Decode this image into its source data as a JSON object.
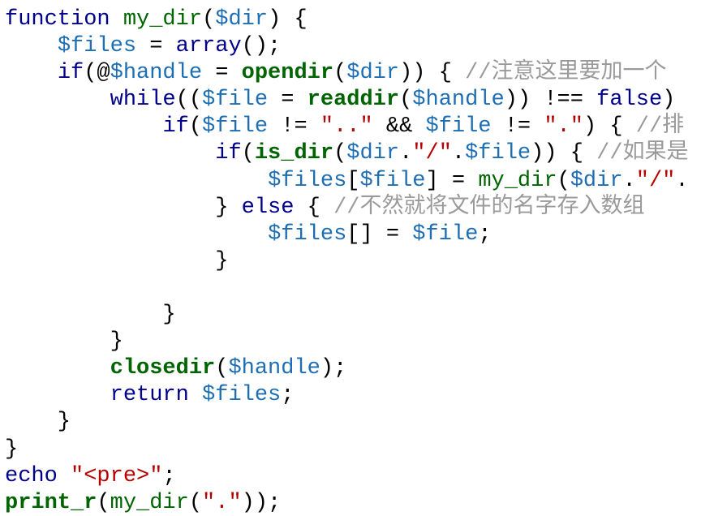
{
  "colors": {
    "background": "#FFFFFF",
    "plain": "#000000",
    "keyword": "#00008B",
    "function": "#006400",
    "builtin": "#006400",
    "variable": "#1E6EB4",
    "string": "#B40000",
    "comment": "#9A9A9A"
  },
  "code": {
    "lines": [
      [
        {
          "t": "keyword",
          "v": "function"
        },
        {
          "t": "plain",
          "v": " "
        },
        {
          "t": "func",
          "v": "my_dir"
        },
        {
          "t": "plain",
          "v": "("
        },
        {
          "t": "var",
          "v": "$dir"
        },
        {
          "t": "plain",
          "v": ") {"
        }
      ],
      [
        {
          "t": "plain",
          "v": "    "
        },
        {
          "t": "var",
          "v": "$files"
        },
        {
          "t": "plain",
          "v": " = "
        },
        {
          "t": "keyword",
          "v": "array"
        },
        {
          "t": "plain",
          "v": "();"
        }
      ],
      [
        {
          "t": "plain",
          "v": "    "
        },
        {
          "t": "keyword",
          "v": "if"
        },
        {
          "t": "plain",
          "v": "(@"
        },
        {
          "t": "var",
          "v": "$handle"
        },
        {
          "t": "plain",
          "v": " = "
        },
        {
          "t": "builtin",
          "v": "opendir"
        },
        {
          "t": "plain",
          "v": "("
        },
        {
          "t": "var",
          "v": "$dir"
        },
        {
          "t": "plain",
          "v": ")) { "
        },
        {
          "t": "comment",
          "v": "//注意这里要加一个"
        }
      ],
      [
        {
          "t": "plain",
          "v": "        "
        },
        {
          "t": "keyword",
          "v": "while"
        },
        {
          "t": "plain",
          "v": "(("
        },
        {
          "t": "var",
          "v": "$file"
        },
        {
          "t": "plain",
          "v": " = "
        },
        {
          "t": "builtin",
          "v": "readdir"
        },
        {
          "t": "plain",
          "v": "("
        },
        {
          "t": "var",
          "v": "$handle"
        },
        {
          "t": "plain",
          "v": ")) !== "
        },
        {
          "t": "keyword",
          "v": "false"
        },
        {
          "t": "plain",
          "v": ") "
        }
      ],
      [
        {
          "t": "plain",
          "v": "            "
        },
        {
          "t": "keyword",
          "v": "if"
        },
        {
          "t": "plain",
          "v": "("
        },
        {
          "t": "var",
          "v": "$file"
        },
        {
          "t": "plain",
          "v": " != "
        },
        {
          "t": "string",
          "v": "\"..\""
        },
        {
          "t": "plain",
          "v": " && "
        },
        {
          "t": "var",
          "v": "$file"
        },
        {
          "t": "plain",
          "v": " != "
        },
        {
          "t": "string",
          "v": "\".\""
        },
        {
          "t": "plain",
          "v": ") { "
        },
        {
          "t": "comment",
          "v": "//排"
        }
      ],
      [
        {
          "t": "plain",
          "v": "                "
        },
        {
          "t": "keyword",
          "v": "if"
        },
        {
          "t": "plain",
          "v": "("
        },
        {
          "t": "builtin",
          "v": "is_dir"
        },
        {
          "t": "plain",
          "v": "("
        },
        {
          "t": "var",
          "v": "$dir"
        },
        {
          "t": "plain",
          "v": "."
        },
        {
          "t": "string",
          "v": "\"/\""
        },
        {
          "t": "plain",
          "v": "."
        },
        {
          "t": "var",
          "v": "$file"
        },
        {
          "t": "plain",
          "v": ")) { "
        },
        {
          "t": "comment",
          "v": "//如果是"
        }
      ],
      [
        {
          "t": "plain",
          "v": "                    "
        },
        {
          "t": "var",
          "v": "$files"
        },
        {
          "t": "plain",
          "v": "["
        },
        {
          "t": "var",
          "v": "$file"
        },
        {
          "t": "plain",
          "v": "] = "
        },
        {
          "t": "func",
          "v": "my_dir"
        },
        {
          "t": "plain",
          "v": "("
        },
        {
          "t": "var",
          "v": "$dir"
        },
        {
          "t": "plain",
          "v": "."
        },
        {
          "t": "string",
          "v": "\"/\""
        },
        {
          "t": "plain",
          "v": "."
        }
      ],
      [
        {
          "t": "plain",
          "v": "                } "
        },
        {
          "t": "keyword",
          "v": "else"
        },
        {
          "t": "plain",
          "v": " { "
        },
        {
          "t": "comment",
          "v": "//不然就将文件的名字存入数组"
        }
      ],
      [
        {
          "t": "plain",
          "v": "                    "
        },
        {
          "t": "var",
          "v": "$files"
        },
        {
          "t": "plain",
          "v": "[] = "
        },
        {
          "t": "var",
          "v": "$file"
        },
        {
          "t": "plain",
          "v": ";"
        }
      ],
      [
        {
          "t": "plain",
          "v": "                }"
        }
      ],
      [
        {
          "t": "plain",
          "v": ""
        }
      ],
      [
        {
          "t": "plain",
          "v": "            }"
        }
      ],
      [
        {
          "t": "plain",
          "v": "        }"
        }
      ],
      [
        {
          "t": "plain",
          "v": "        "
        },
        {
          "t": "builtin",
          "v": "closedir"
        },
        {
          "t": "plain",
          "v": "("
        },
        {
          "t": "var",
          "v": "$handle"
        },
        {
          "t": "plain",
          "v": ");"
        }
      ],
      [
        {
          "t": "plain",
          "v": "        "
        },
        {
          "t": "keyword",
          "v": "return"
        },
        {
          "t": "plain",
          "v": " "
        },
        {
          "t": "var",
          "v": "$files"
        },
        {
          "t": "plain",
          "v": ";"
        }
      ],
      [
        {
          "t": "plain",
          "v": "    }"
        }
      ],
      [
        {
          "t": "plain",
          "v": "}"
        }
      ],
      [
        {
          "t": "keyword",
          "v": "echo"
        },
        {
          "t": "plain",
          "v": " "
        },
        {
          "t": "string",
          "v": "\"<pre>\""
        },
        {
          "t": "plain",
          "v": ";"
        }
      ],
      [
        {
          "t": "builtin",
          "v": "print_r"
        },
        {
          "t": "plain",
          "v": "("
        },
        {
          "t": "func",
          "v": "my_dir"
        },
        {
          "t": "plain",
          "v": "("
        },
        {
          "t": "string",
          "v": "\".\""
        },
        {
          "t": "plain",
          "v": "));"
        }
      ]
    ]
  }
}
